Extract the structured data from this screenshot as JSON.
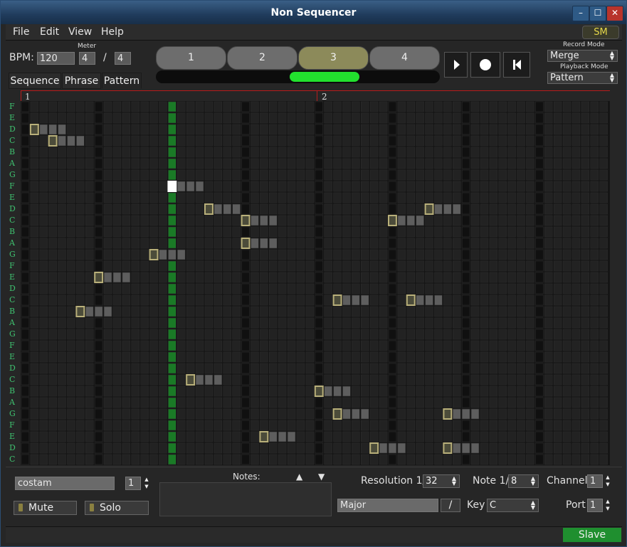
{
  "window": {
    "title": "Non Sequencer"
  },
  "menu": {
    "file": "File",
    "edit": "Edit",
    "view": "View",
    "help": "Help",
    "sm": "SM"
  },
  "transport": {
    "bpm_label": "BPM:",
    "bpm": "120",
    "meter_label": "Meter",
    "meter_beats": "4",
    "meter_sep": "/",
    "meter_unit": "4",
    "sequence_slots": [
      "1",
      "2",
      "3",
      "4"
    ],
    "active_slot": "3",
    "record_mode_label": "Record Mode",
    "record_mode": "Merge",
    "playback_mode_label": "Playback Mode",
    "playback_mode": "Pattern"
  },
  "tabs": {
    "sequence": "Sequence",
    "phrase": "Phrase",
    "pattern": "Pattern",
    "active": "Pattern"
  },
  "ruler": {
    "bar1": "1",
    "bar2": "2"
  },
  "grid": {
    "cols": 32,
    "rows": 32,
    "note_labels": [
      "F",
      "E",
      "D",
      "C",
      "B",
      "A",
      "G",
      "F",
      "E",
      "D",
      "C",
      "B",
      "A",
      "G",
      "F",
      "E",
      "D",
      "C",
      "B",
      "A",
      "G",
      "F",
      "E",
      "D",
      "C",
      "B",
      "A",
      "G",
      "F",
      "E",
      "D",
      "C"
    ],
    "playhead_col": 16,
    "notes": [
      {
        "row": 2,
        "col": 1,
        "len": 4
      },
      {
        "row": 3,
        "col": 3,
        "len": 4
      },
      {
        "row": 7,
        "col": 16,
        "len": 4,
        "selected": true
      },
      {
        "row": 9,
        "col": 20,
        "len": 4
      },
      {
        "row": 9,
        "col": 44,
        "len": 4
      },
      {
        "row": 10,
        "col": 24,
        "len": 4
      },
      {
        "row": 10,
        "col": 40,
        "len": 4
      },
      {
        "row": 12,
        "col": 24,
        "len": 4
      },
      {
        "row": 13,
        "col": 14,
        "len": 4
      },
      {
        "row": 15,
        "col": 8,
        "len": 4
      },
      {
        "row": 17,
        "col": 34,
        "len": 4
      },
      {
        "row": 17,
        "col": 42,
        "len": 4
      },
      {
        "row": 18,
        "col": 6,
        "len": 4
      },
      {
        "row": 24,
        "col": 18,
        "len": 4
      },
      {
        "row": 25,
        "col": 32,
        "len": 4
      },
      {
        "row": 27,
        "col": 34,
        "len": 4
      },
      {
        "row": 27,
        "col": 46,
        "len": 4
      },
      {
        "row": 29,
        "col": 26,
        "len": 4
      },
      {
        "row": 30,
        "col": 38,
        "len": 4
      },
      {
        "row": 30,
        "col": 46,
        "len": 4
      }
    ]
  },
  "pattern_panel": {
    "name": "costam",
    "number": "1",
    "mute": "Mute",
    "solo": "Solo",
    "notes_label": "Notes:",
    "resolution_label": "Resolution 1/",
    "resolution": "32",
    "note_label": "Note 1/",
    "note": "8",
    "channel_label": "Channel",
    "channel": "1",
    "scale": "Major",
    "scale_btn": "/",
    "key_label": "Key",
    "key": "C",
    "port_label": "Port",
    "port": "1"
  },
  "status": {
    "slave": "Slave"
  },
  "colors": {
    "playhead": "#1a7a26",
    "note_head": "#b9b07a",
    "note_tail": "#5e5e5e",
    "active_slot": "#8c8a5a",
    "progress": "#22e02e",
    "label_green": "#3fc06f"
  }
}
